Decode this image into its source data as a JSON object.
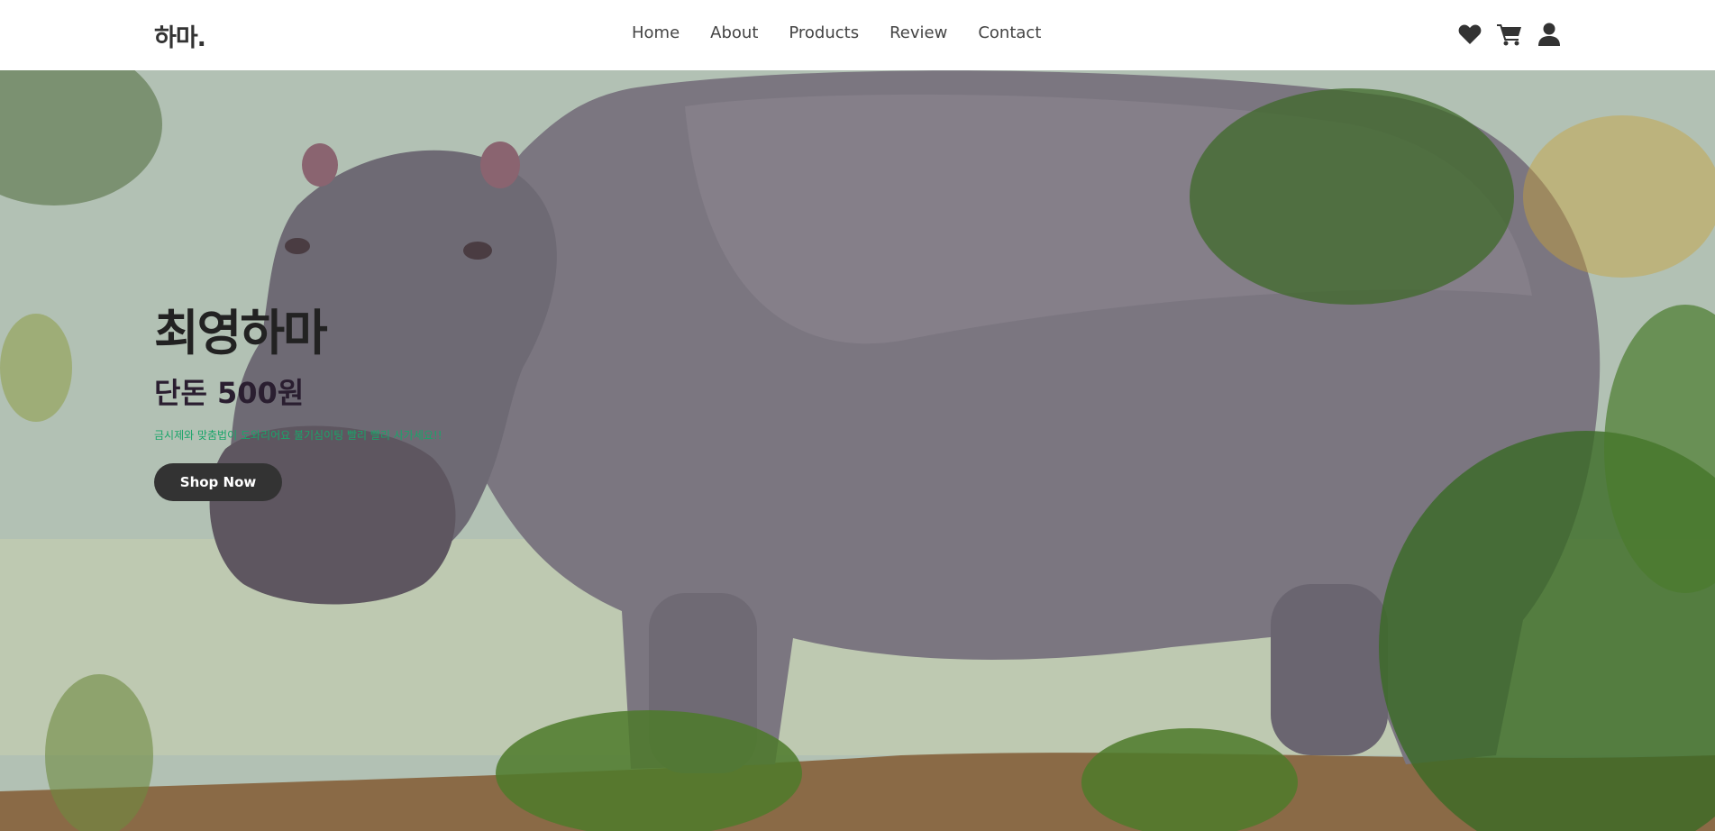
{
  "header": {
    "logo": "하마.",
    "nav": [
      "Home",
      "About",
      "Products",
      "Review",
      "Contact"
    ],
    "icons": [
      "heart-icon",
      "cart-icon",
      "user-icon"
    ]
  },
  "hero": {
    "title": "최영하마",
    "subtitle": "단돈 500원",
    "description": "금시제와 맞춤법이 도와리어요 불기심이팅 빨리 빨리 사가세요!!",
    "cta_label": "Shop Now",
    "image": "hippo-photo"
  },
  "colors": {
    "header_bg": "#ffffff",
    "text_dark": "#333333",
    "accent_green": "#1aa56a",
    "button_bg": "#333333"
  }
}
